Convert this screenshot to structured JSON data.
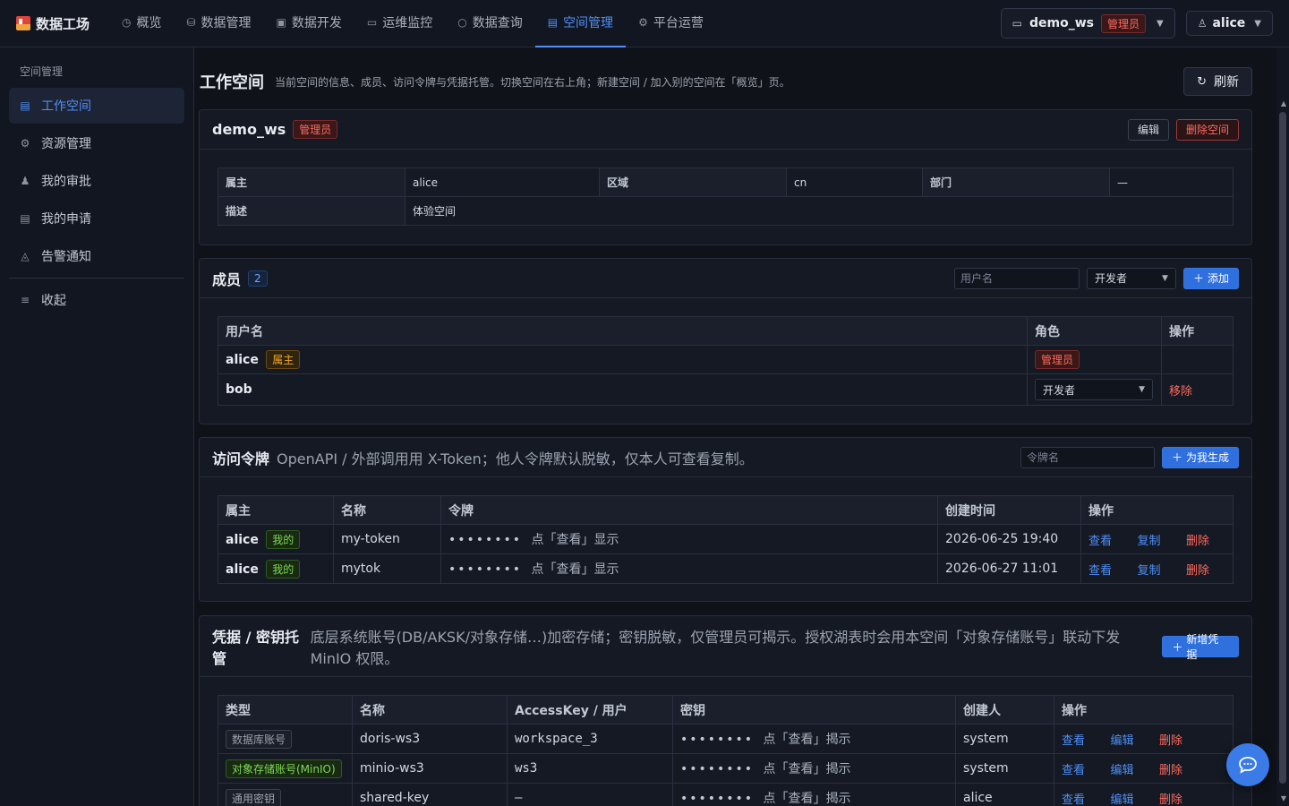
{
  "brand": {
    "name": "数据工场"
  },
  "nav": {
    "tabs": [
      {
        "label": "概览",
        "icon": "dashboard-icon"
      },
      {
        "label": "数据管理",
        "icon": "database-icon"
      },
      {
        "label": "数据开发",
        "icon": "code-icon"
      },
      {
        "label": "运维监控",
        "icon": "monitor-icon"
      },
      {
        "label": "数据查询",
        "icon": "search-icon"
      },
      {
        "label": "空间管理",
        "icon": "building-icon",
        "active": true
      },
      {
        "label": "平台运营",
        "icon": "gear-icon"
      }
    ]
  },
  "workspace_select": {
    "name": "demo_ws",
    "role": "管理员"
  },
  "user_select": {
    "name": "alice"
  },
  "sidebar": {
    "group": "空间管理",
    "items": [
      {
        "label": "工作空间",
        "icon": "building-icon",
        "active": true
      },
      {
        "label": "资源管理",
        "icon": "gear-icon"
      },
      {
        "label": "我的审批",
        "icon": "user-icon"
      },
      {
        "label": "我的申请",
        "icon": "document-icon"
      },
      {
        "label": "告警通知",
        "icon": "bell-icon"
      }
    ],
    "collapse": "收起"
  },
  "page": {
    "title": "工作空间",
    "desc": "当前空间的信息、成员、访问令牌与凭据托管。切换空间在右上角；新建空间 / 加入别的空间在「概览」页。",
    "refresh": "刷新"
  },
  "ws_card": {
    "name": "demo_ws",
    "role": "管理员",
    "edit": "编辑",
    "delete": "删除空间",
    "info": {
      "owner_label": "属主",
      "owner": "alice",
      "region_label": "区域",
      "region": "cn",
      "dept_label": "部门",
      "dept": "—",
      "desc_label": "描述",
      "desc": "体验空间"
    }
  },
  "members": {
    "title": "成员",
    "count": "2",
    "username_placeholder": "用户名",
    "role_value": "开发者",
    "add": "添加",
    "headers": [
      "用户名",
      "角色",
      "操作"
    ],
    "rows": [
      {
        "name": "alice",
        "badge": "属主",
        "role": "管理员",
        "action": ""
      },
      {
        "name": "bob",
        "badge": "",
        "role": "开发者",
        "action": "移除"
      }
    ]
  },
  "tokens": {
    "title": "访问令牌",
    "subtitle": "OpenAPI / 外部调用用 X-Token；他人令牌默认脱敏，仅本人可查看复制。",
    "name_placeholder": "令牌名",
    "generate": "为我生成",
    "headers": [
      "属主",
      "名称",
      "令牌",
      "创建时间",
      "操作"
    ],
    "rows": [
      {
        "owner": "alice",
        "badge": "我的",
        "name": "my-token",
        "token": "••••••••",
        "hint": "点「查看」显示",
        "created": "2026-06-25 19:40"
      },
      {
        "owner": "alice",
        "badge": "我的",
        "name": "mytok",
        "token": "••••••••",
        "hint": "点「查看」显示",
        "created": "2026-06-27 11:01"
      }
    ],
    "actions": {
      "view": "查看",
      "copy": "复制",
      "delete": "删除"
    }
  },
  "credentials": {
    "title": "凭据 / 密钥托管",
    "subtitle": "底层系统账号(DB/AKSK/对象存储…)加密存储；密钥脱敏，仅管理员可揭示。授权湖表时会用本空间「对象存储账号」联动下发 MinIO 权限。",
    "add": "新增凭据",
    "headers": [
      "类型",
      "名称",
      "AccessKey / 用户",
      "密钥",
      "创建人",
      "操作"
    ],
    "rows": [
      {
        "type": "数据库账号",
        "type_style": "gray",
        "name": "doris-ws3",
        "access": "workspace_3",
        "secret": "••••••••",
        "hint": "点「查看」揭示",
        "creator": "system"
      },
      {
        "type": "对象存储账号(MinIO)",
        "type_style": "green",
        "name": "minio-ws3",
        "access": "ws3",
        "secret": "••••••••",
        "hint": "点「查看」揭示",
        "creator": "system"
      },
      {
        "type": "通用密钥",
        "type_style": "gray",
        "name": "shared-key",
        "access": "—",
        "secret": "••••••••",
        "hint": "点「查看」揭示",
        "creator": "alice"
      }
    ],
    "actions": {
      "view": "查看",
      "edit": "编辑",
      "delete": "删除"
    }
  }
}
